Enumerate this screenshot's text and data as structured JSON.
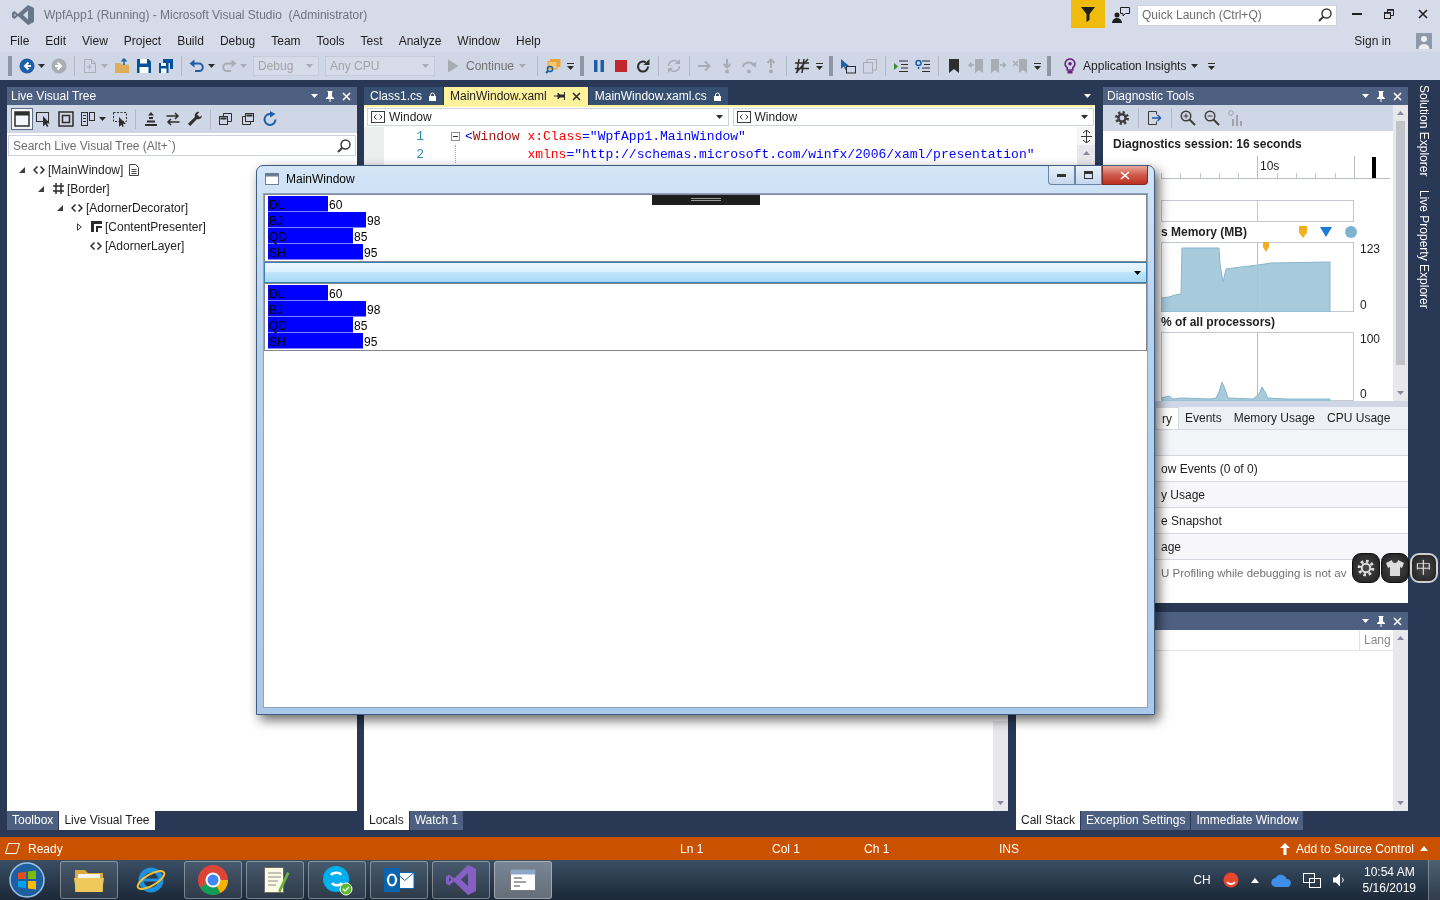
{
  "window": {
    "title": "WpfApp1 (Running) - Microsoft Visual Studio  (Administrator)"
  },
  "quick_launch": {
    "placeholder": "Quick Launch (Ctrl+Q)"
  },
  "menu": [
    "File",
    "Edit",
    "View",
    "Project",
    "Build",
    "Debug",
    "Team",
    "Tools",
    "Test",
    "Analyze",
    "Window",
    "Help"
  ],
  "account": {
    "label": "Sign in"
  },
  "toolbars": [
    {
      "items": [
        {
          "kind": "icon",
          "disabled": false
        },
        {
          "kind": "icon",
          "disabled": true
        },
        {
          "kind": "separator"
        },
        {
          "kind": "icon",
          "disabled": true
        },
        {
          "kind": "icon",
          "disabled": false
        },
        {
          "kind": "icon",
          "disabled": false
        },
        {
          "kind": "icon",
          "disabled": false
        },
        {
          "kind": "separator"
        },
        {
          "kind": "icon",
          "disabled": false
        },
        {
          "kind": "icon",
          "disabled": true
        },
        {
          "kind": "combo",
          "value": "Debug",
          "disabled": true
        },
        {
          "kind": "combo",
          "value": "Any CPU",
          "disabled": true
        },
        {
          "kind": "command",
          "label": "Continue",
          "disabled": true
        },
        {
          "kind": "separator"
        },
        {
          "kind": "icon",
          "disabled": false
        }
      ]
    },
    {
      "items": [
        {
          "kind": "icon",
          "disabled": false
        },
        {
          "kind": "icon",
          "disabled": false
        },
        {
          "kind": "icon",
          "disabled": false
        },
        {
          "kind": "separator"
        },
        {
          "kind": "icon",
          "disabled": true
        },
        {
          "kind": "separator"
        },
        {
          "kind": "icon",
          "disabled": true
        },
        {
          "kind": "icon",
          "disabled": true
        },
        {
          "kind": "icon",
          "disabled": true
        },
        {
          "kind": "icon",
          "disabled": true
        },
        {
          "kind": "separator"
        },
        {
          "kind": "icon",
          "disabled": false
        }
      ]
    },
    {
      "items": [
        {
          "kind": "icon",
          "disabled": false
        },
        {
          "kind": "icon",
          "disabled": true
        },
        {
          "kind": "separator"
        },
        {
          "kind": "icon",
          "disabled": false
        },
        {
          "kind": "icon",
          "disabled": false
        },
        {
          "kind": "separator"
        },
        {
          "kind": "icon",
          "disabled": false
        },
        {
          "kind": "icon",
          "disabled": true
        },
        {
          "kind": "icon",
          "disabled": true
        },
        {
          "kind": "icon",
          "disabled": true
        }
      ]
    },
    {
      "items": [
        {
          "kind": "command",
          "label": "Application Insights",
          "disabled": false
        }
      ]
    }
  ],
  "live_visual_tree": {
    "title": "Live Visual Tree",
    "toolbar": [
      {
        "kind": "toggle",
        "on": true
      },
      {
        "kind": "toggle",
        "on": false
      },
      {
        "kind": "toggle",
        "on": false
      },
      {
        "kind": "toggle",
        "on": false
      },
      {
        "kind": "toggle",
        "on": false
      },
      {
        "kind": "separator"
      },
      {
        "kind": "toggle",
        "on": false
      },
      {
        "kind": "button"
      },
      {
        "kind": "button"
      },
      {
        "kind": "separator"
      },
      {
        "kind": "button"
      },
      {
        "kind": "button"
      },
      {
        "kind": "button"
      }
    ],
    "search": {
      "placeholder": "Search Live Visual Tree (Alt+`)"
    },
    "tree": [
      {
        "label": "[MainWindow]",
        "kind": "window",
        "expanded": true,
        "children": [
          {
            "label": "[Border]",
            "kind": "border",
            "expanded": true,
            "children": [
              {
                "label": "[AdornerDecorator]",
                "kind": "element",
                "expanded": true,
                "children": [
                  {
                    "label": "[ContentPresenter]",
                    "kind": "presenter",
                    "expanded": false
                  },
                  {
                    "label": "[AdornerLayer]",
                    "kind": "element"
                  }
                ]
              }
            ]
          }
        ]
      }
    ],
    "tabs": [
      {
        "label": "Toolbox",
        "selected": false
      },
      {
        "label": "Live Visual Tree",
        "selected": true
      }
    ]
  },
  "editor": {
    "tabs": [
      {
        "label": "Class1.cs",
        "selected": false,
        "read_only": true
      },
      {
        "label": "MainWindow.xaml",
        "selected": true,
        "read_only": false
      },
      {
        "label": "MainWindow.xaml.cs",
        "selected": false,
        "read_only": true
      }
    ],
    "navigation": [
      "Window",
      "Window"
    ],
    "lines": [
      {
        "number": "1",
        "expanded": true,
        "tokens": [
          {
            "kind": "delimiter",
            "text": "<"
          },
          {
            "kind": "element",
            "text": "Window"
          },
          {
            "kind": "attribute",
            "text": " x:Class"
          },
          {
            "kind": "value",
            "text": "=\"WpfApp1.MainWindow\""
          }
        ]
      },
      {
        "number": "2",
        "tokens": [
          {
            "kind": "attribute",
            "text": "        xmlns"
          },
          {
            "kind": "value",
            "text": "=\"http://schemas.microsoft.com/winfx/2006/xaml/presentation\""
          }
        ]
      }
    ]
  },
  "locals": {
    "tabs": [
      {
        "label": "Locals",
        "selected": true
      },
      {
        "label": "Watch 1",
        "selected": false
      }
    ]
  },
  "diagnostics": {
    "title": "Diagnostic Tools",
    "session": "Diagnostics session: 16 seconds",
    "ruler_label": "10s",
    "memory": {
      "title": "s Memory (MB)",
      "axis_max": "123",
      "axis_min": "0"
    },
    "cpu": {
      "title": "% of all processors)",
      "axis_max": "100",
      "axis_min": "0"
    },
    "tabs": [
      {
        "label": "ry",
        "selected": true
      },
      {
        "label": "Events",
        "selected": false
      },
      {
        "label": "Memory Usage",
        "selected": false
      },
      {
        "label": "CPU Usage",
        "selected": false
      }
    ],
    "rows": [
      {
        "kind": "item",
        "text": "ow Events (0 of 0)"
      },
      {
        "kind": "section",
        "text": "y Usage"
      },
      {
        "kind": "item",
        "text": "e Snapshot"
      },
      {
        "kind": "section",
        "text": "age"
      },
      {
        "kind": "note",
        "text": "U Profiling while debugging is not av"
      }
    ]
  },
  "call_stack": {
    "columns": [
      "Lang"
    ],
    "tabs": [
      {
        "label": "Call Stack",
        "selected": true
      },
      {
        "label": "Exception Settings",
        "selected": false
      },
      {
        "label": "Immediate Window",
        "selected": false
      }
    ]
  },
  "side_tabs": [
    "Solution Explorer",
    "Live Property Explorer"
  ],
  "app_window": {
    "title": "MainWindow",
    "lists": [
      {
        "chart_data": {
          "type": "bar",
          "orientation": "horizontal",
          "categories": [
            "DL",
            "BJ",
            "QD",
            "SH"
          ],
          "values": [
            60,
            98,
            85,
            95
          ],
          "data_labels": true
        }
      },
      {
        "chart_data": {
          "type": "bar",
          "orientation": "horizontal",
          "categories": [
            "DL",
            "BJ",
            "QD",
            "SH"
          ],
          "values": [
            60,
            98,
            85,
            95
          ],
          "data_labels": true
        }
      }
    ]
  },
  "ime_toolbar": {
    "label": "中"
  },
  "status_bar": {
    "message": "Ready",
    "line": "Ln 1",
    "column": "Col 1",
    "character": "Ch 1",
    "mode": "INS",
    "source_control": "Add to Source Control"
  },
  "taskbar": {
    "apps": [
      {
        "running": true,
        "active": false
      },
      {
        "running": false,
        "active": false
      },
      {
        "running": true,
        "active": false
      },
      {
        "running": true,
        "active": false
      },
      {
        "running": true,
        "active": false
      },
      {
        "running": true,
        "active": false
      },
      {
        "running": true,
        "active": false
      },
      {
        "running": true,
        "active": true
      }
    ],
    "language": "CH",
    "time": "10:54 AM",
    "date": "5/16/2019"
  }
}
